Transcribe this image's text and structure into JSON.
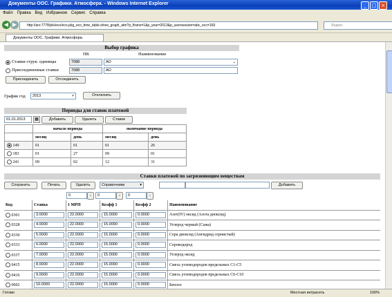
{
  "window": {
    "title": "Документы ООС. Графики. Атмосфера. - Windows Internet Explorer"
  },
  "menu": [
    "Файл",
    "Правка",
    "Вид",
    "Избранное",
    "Сервис",
    "Справка"
  ],
  "address": {
    "url": "http://ars:7778/pls/eco/eco.pkg_eco_time_table.show_graph_atm?p_ftrans=1&p_year=2013&p_usersession=abc_ecc=169",
    "search_placeholder": "Яндекс"
  },
  "tab": {
    "label": "Документы ООС. Графики. Атмосфера."
  },
  "select_schedule": {
    "header": "Выбор графика",
    "col_pk": "ПК",
    "col_name": "Наименование",
    "option1_label": "Ставки струк. единицы",
    "option1_code": "7088",
    "option1_name": "АО",
    "option2_label": "Присоединенные ставки",
    "option2_code": "7088",
    "option2_name": "АО",
    "attach_btn": "Присоединить",
    "detach_btn": "Отсоединить",
    "year_label": "График год",
    "year_value": "2013",
    "disable_btn": "Отключить"
  },
  "periods": {
    "header": "Периоды для ставок платежей",
    "date": "01.01.2013",
    "add_btn": "Добавить",
    "delete_btn": "Удалить",
    "rates_btn": "Ставки",
    "start_header": "начало периода",
    "end_header": "окончание периода",
    "month": "месяц",
    "day": "день",
    "rows": [
      {
        "id": "149",
        "sm": "01",
        "sd": "01",
        "em": "01",
        "ed": "26",
        "selected": true
      },
      {
        "id": "183",
        "sm": "01",
        "sd": "27",
        "em": "09",
        "ed": "01",
        "selected": false
      },
      {
        "id": "241",
        "sm": "09",
        "sd": "02",
        "em": "12",
        "ed": "31",
        "selected": false
      }
    ]
  },
  "rates": {
    "header": "Ставки платежей по загрязняющим веществам",
    "save_btn": "Сохранить",
    "print_btn": "Печать",
    "delete_btn": "Удалить",
    "ref_select": "Справочники",
    "add_btn": "Добавить",
    "filter1": "0",
    "filter2": "0",
    "filter3": "0",
    "col_code": "Код",
    "col_rate": "Ставка",
    "col_mrp": "1 МРП",
    "col_k1": "Коэфф 1",
    "col_k2": "Коэфф 2",
    "col_name": "Наименование",
    "rows": [
      {
        "code": "0301",
        "rate": "3.0000",
        "mrp": "22.0000",
        "k1": "15.0000",
        "k2": "0.0000",
        "name": "Азот(IV) оксид (Азота диоксид)"
      },
      {
        "code": "0328",
        "rate": "4.0000",
        "mrp": "22.0000",
        "k1": "15.0000",
        "k2": "0.0000",
        "name": "Углерод черный (Сажа)"
      },
      {
        "code": "0330",
        "rate": "5.0000",
        "mrp": "22.0000",
        "k1": "15.0000",
        "k2": "0.0000",
        "name": "Сера диоксид (Ангидрид сернистый)"
      },
      {
        "code": "0333",
        "rate": "6.0000",
        "mrp": "22.0000",
        "k1": "15.0000",
        "k2": "0.0000",
        "name": "Сероводород"
      },
      {
        "code": "0337",
        "rate": "7.0000",
        "mrp": "22.0000",
        "k1": "15.0000",
        "k2": "0.0000",
        "name": "Углерод оксид"
      },
      {
        "code": "0415",
        "rate": "8.0000",
        "mrp": "22.0000",
        "k1": "15.0000",
        "k2": "0.0000",
        "name": "Смесь углеводородов предельных С1-С5"
      },
      {
        "code": "0416",
        "rate": "9.0000",
        "mrp": "22.0000",
        "k1": "15.0000",
        "k2": "0.0000",
        "name": "Смесь углеводородов предельных С6-С10"
      },
      {
        "code": "0602",
        "rate": "10.0000",
        "mrp": "22.0000",
        "k1": "15.0000",
        "k2": "0.0000",
        "name": "Бензол"
      }
    ]
  },
  "status": {
    "left": "Готово",
    "zone": "Местная интрасеть",
    "zoom": "100%"
  }
}
